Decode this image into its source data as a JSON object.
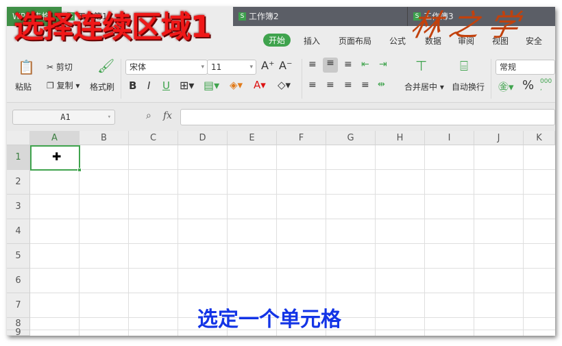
{
  "tabs": [
    {
      "label": "WPS 表格"
    },
    {
      "label": "工作簿1",
      "icon": "S"
    },
    {
      "label": "工作簿2",
      "icon": "S"
    },
    {
      "label": "工作簿3",
      "icon": "S"
    }
  ],
  "menu": {
    "items": [
      "开始",
      "插入",
      "页面布局",
      "公式",
      "数据",
      "审阅",
      "视图",
      "安全"
    ]
  },
  "ribbon": {
    "paste": "粘贴",
    "cut": "剪切",
    "copy": "复制",
    "format_painter": "格式刷",
    "font": "宋体",
    "size": "11",
    "merge": "合并居中",
    "wrap": "自动换行",
    "number_format": "常规",
    "percent": "%"
  },
  "formula_bar": {
    "name_box": "A1",
    "fx": "fx",
    "value": ""
  },
  "columns": [
    "A",
    "B",
    "C",
    "D",
    "E",
    "F",
    "G",
    "H",
    "I",
    "J",
    "K"
  ],
  "rows": [
    "1",
    "2",
    "3",
    "4",
    "5",
    "6",
    "7",
    "8",
    "9"
  ],
  "overlay_title": "选择连续区域1",
  "signature": "林之学",
  "caption": "选定一个单元格",
  "colors": {
    "accent": "#3fa34d",
    "overlay": "#f01818",
    "caption": "#1334e6"
  }
}
